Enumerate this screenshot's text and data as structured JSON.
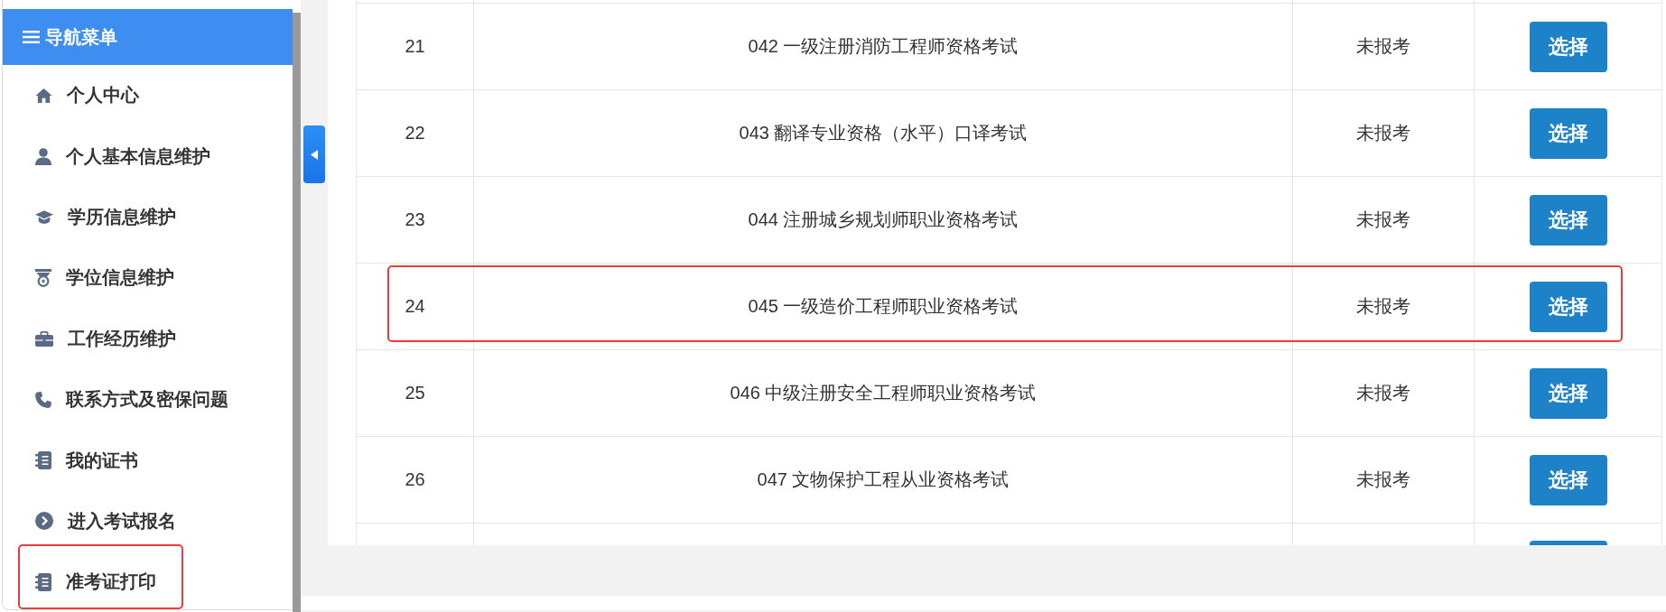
{
  "sidebar": {
    "title": "导航菜单",
    "items": [
      {
        "label": "个人中心",
        "highlighted": false
      },
      {
        "label": "个人基本信息维护",
        "highlighted": false
      },
      {
        "label": "学历信息维护",
        "highlighted": false
      },
      {
        "label": "学位信息维护",
        "highlighted": false
      },
      {
        "label": "工作经历维护",
        "highlighted": false
      },
      {
        "label": "联系方式及密保问题",
        "highlighted": false
      },
      {
        "label": "我的证书",
        "highlighted": false
      },
      {
        "label": "进入考试报名",
        "highlighted": false
      },
      {
        "label": "准考证打印",
        "highlighted": true
      }
    ]
  },
  "table": {
    "more_above": true,
    "rows": [
      {
        "number": "21",
        "exam": "042 一级注册消防工程师资格考试",
        "status": "未报考",
        "action": "选择",
        "highlighted": false
      },
      {
        "number": "22",
        "exam": "043 翻译专业资格（水平）口译考试",
        "status": "未报考",
        "action": "选择",
        "highlighted": false
      },
      {
        "number": "23",
        "exam": "044 注册城乡规划师职业资格考试",
        "status": "未报考",
        "action": "选择",
        "highlighted": false
      },
      {
        "number": "24",
        "exam": "045 一级造价工程师职业资格考试",
        "status": "未报考",
        "action": "选择",
        "highlighted": true
      },
      {
        "number": "25",
        "exam": "046 中级注册安全工程师职业资格考试",
        "status": "未报考",
        "action": "选择",
        "highlighted": false
      },
      {
        "number": "26",
        "exam": "047 文物保护工程从业资格考试",
        "status": "未报考",
        "action": "选择",
        "highlighted": false
      }
    ],
    "more_below": true
  }
}
